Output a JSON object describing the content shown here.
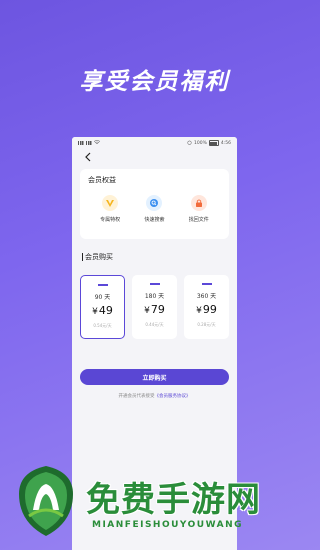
{
  "banner": {
    "title": "享受会员福利"
  },
  "status_bar": {
    "battery": "100%",
    "time": "4:56"
  },
  "benefits": {
    "title": "会员权益",
    "items": [
      {
        "label": "专属特权",
        "icon": "vip-crown-icon"
      },
      {
        "label": "快速搜索",
        "icon": "search-icon"
      },
      {
        "label": "找回文件",
        "icon": "lock-icon"
      }
    ]
  },
  "purchase": {
    "title": "会员购买",
    "plans": [
      {
        "days": "90 天",
        "currency": "¥",
        "price": "49",
        "unit": "0.54元/天",
        "selected": true
      },
      {
        "days": "180 天",
        "currency": "¥",
        "price": "79",
        "unit": "0.44元/天",
        "selected": false
      },
      {
        "days": "360 天",
        "currency": "¥",
        "price": "99",
        "unit": "0.28元/天",
        "selected": false
      }
    ],
    "buy_label": "立即购买",
    "agreement_prefix": "开通会员代表接受",
    "agreement_link": "《会员服务协议》"
  },
  "watermark": {
    "text": "免费手游网",
    "sub": "MIANFEISHOUYOUWANG"
  },
  "colors": {
    "accent": "#5a47d4",
    "background": "#7e66ee",
    "watermark": "#2a8d3a"
  }
}
